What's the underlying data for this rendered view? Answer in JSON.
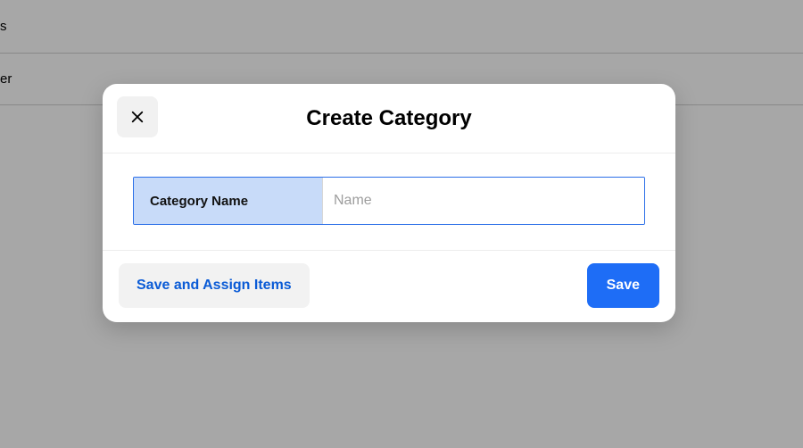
{
  "background": {
    "row1_fragment": "s",
    "row2_fragment": "er"
  },
  "modal": {
    "title": "Create Category",
    "close_icon_label": "Close",
    "field": {
      "label": "Category Name",
      "placeholder": "Name",
      "value": ""
    },
    "footer": {
      "secondary_label": "Save and Assign Items",
      "primary_label": "Save"
    }
  }
}
